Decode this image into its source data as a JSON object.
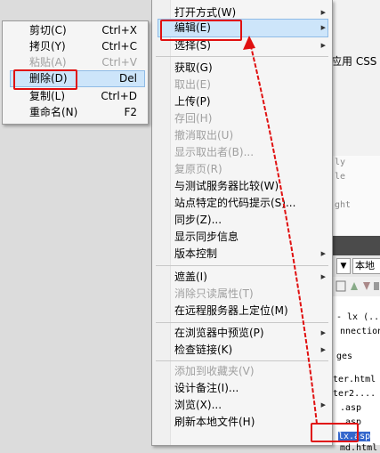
{
  "background": {
    "top_text": "应用 CSS",
    "code_lines": [
      "ly",
      "le",
      "",
      "ght"
    ],
    "location_select": "本地",
    "dropdown_arrow": "▼",
    "file_lines": [
      "- lx (...",
      "nnections",
      "ges",
      "ter.html",
      "ter2....",
      ".asp",
      ".asp",
      "lx.asp",
      "md.html"
    ]
  },
  "context_submenu": {
    "items": [
      {
        "label": "剪切(C)",
        "shortcut": "Ctrl+X",
        "disabled": false
      },
      {
        "label": "拷贝(Y)",
        "shortcut": "Ctrl+C",
        "disabled": false
      },
      {
        "label": "粘贴(A)",
        "shortcut": "Ctrl+V",
        "disabled": true
      },
      {
        "label": "删除(D)",
        "shortcut": "Del",
        "disabled": false,
        "highlighted": true
      },
      {
        "label": "复制(L)",
        "shortcut": "Ctrl+D",
        "disabled": false
      },
      {
        "label": "重命名(N)",
        "shortcut": "F2",
        "disabled": false
      }
    ]
  },
  "context_menu": {
    "items": [
      {
        "label": "打开方式(W)",
        "submenu": true
      },
      {
        "label": "编辑(E)",
        "submenu": true,
        "highlighted": true
      },
      {
        "label": "选择(S)",
        "submenu": true
      },
      {
        "label": "获取(G)"
      },
      {
        "label": "取出(E)",
        "disabled": true
      },
      {
        "label": "上传(P)"
      },
      {
        "label": "存回(H)",
        "disabled": true
      },
      {
        "label": "撤消取出(U)",
        "disabled": true
      },
      {
        "label": "显示取出者(B)...",
        "disabled": true
      },
      {
        "label": "复原页(R)",
        "disabled": true
      },
      {
        "label": "与测试服务器比较(W)"
      },
      {
        "label": "站点特定的代码提示(S)..."
      },
      {
        "label": "同步(Z)..."
      },
      {
        "label": "显示同步信息"
      },
      {
        "label": "版本控制",
        "submenu": true
      },
      {
        "label": "遮盖(I)",
        "submenu": true
      },
      {
        "label": "消除只读属性(T)",
        "disabled": true
      },
      {
        "label": "在远程服务器上定位(M)"
      },
      {
        "label": "在浏览器中预览(P)",
        "submenu": true
      },
      {
        "label": "检查链接(K)",
        "submenu": true
      },
      {
        "label": "添加到收藏夹(V)",
        "disabled": true
      },
      {
        "label": "设计备注(I)..."
      },
      {
        "label": "浏览(X)...",
        "submenu": true
      },
      {
        "label": "刷新本地文件(H)"
      }
    ],
    "submenu_arrow": "▶"
  },
  "annotation": {
    "color": "#e01010"
  }
}
